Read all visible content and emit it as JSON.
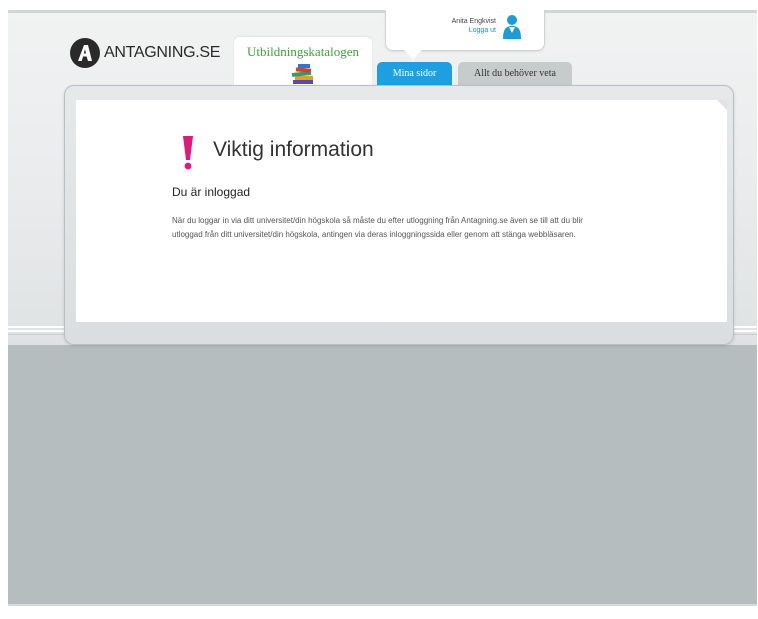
{
  "header": {
    "logo_text": "ANTAGNING.SE",
    "user": {
      "name": "Anita Engkvist",
      "logout_label": "Logga ut"
    },
    "tabs": [
      {
        "label": "Utbildningskatalogen",
        "icon": "books-icon"
      },
      {
        "label": "Mina sidor",
        "active": true
      },
      {
        "label": "Allt du behöver veta"
      }
    ]
  },
  "main": {
    "title": "Viktig information",
    "subtitle": "Du är inloggad",
    "body": "När du loggar in via ditt universitet/din högskola så måste du efter utloggning från Antagning.se även se till att du blir utloggad från ditt universitet/din högskola, antingen via deras inloggningssida eller genom att stänga webbläsaren."
  },
  "colors": {
    "accent_blue": "#1ea0e0",
    "catalog_green": "#3aa33a",
    "exclamation": "#e0197d",
    "background_gray": "#b5bdbf"
  }
}
